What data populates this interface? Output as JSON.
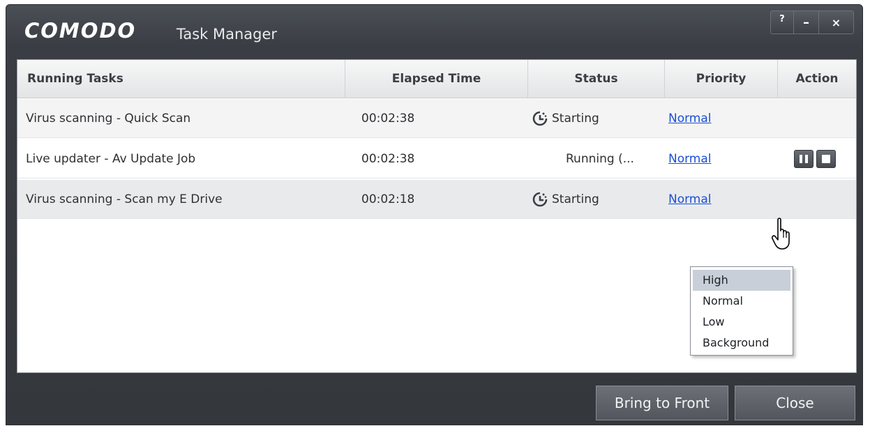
{
  "window": {
    "brand": "COMODO",
    "title": "Task Manager",
    "controls": {
      "help": "?",
      "minimize": "–",
      "close": "×"
    }
  },
  "table": {
    "columns": [
      "Running Tasks",
      "Elapsed Time",
      "Status",
      "Priority",
      "Action"
    ],
    "rows": [
      {
        "task": "Virus scanning - Quick Scan",
        "elapsed": "00:02:38",
        "status": "Starting",
        "status_icon": "clock-icon",
        "priority": "Normal",
        "actions": []
      },
      {
        "task": "Live updater - Av Update Job",
        "elapsed": "00:02:38",
        "status": "Running (...",
        "status_icon": "",
        "priority": "Normal",
        "actions": [
          "pause-icon",
          "stop-icon"
        ]
      },
      {
        "task": "Virus scanning - Scan my E Drive",
        "elapsed": "00:02:18",
        "status": "Starting",
        "status_icon": "clock-icon",
        "priority": "Normal",
        "actions": []
      }
    ]
  },
  "priority_dropdown": {
    "options": [
      "High",
      "Normal",
      "Low",
      "Background"
    ],
    "highlighted": "High"
  },
  "footer": {
    "bring_to_front": "Bring to Front",
    "close": "Close"
  },
  "colors": {
    "window_bg": "#3a3d43",
    "link": "#1a4fd6",
    "selected_row": "#e9eaec"
  }
}
